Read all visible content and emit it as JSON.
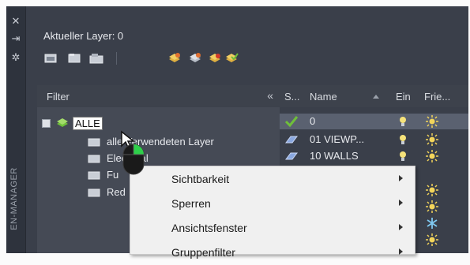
{
  "sidebar": {
    "close_icon": "close-icon",
    "pin_icon": "pin-icon",
    "settings_icon": "settings-icon",
    "title": "EN-MANAGER"
  },
  "header": {
    "current_layer": "Aktueller Layer: 0"
  },
  "toolbar": {
    "icons": [
      "new-property-filter-icon",
      "new-group-filter-icon",
      "layer-states-manager-icon",
      "new-layer-icon",
      "new-layer-vp-frozen-icon",
      "delete-layer-icon",
      "set-current-icon"
    ]
  },
  "filter_panel": {
    "label": "Filter",
    "collapse_glyph": "«",
    "tree": [
      {
        "label": "ALLE",
        "selected": true
      },
      {
        "label": "alle Verwendeten Layer"
      },
      {
        "label": "Electrical"
      },
      {
        "label": "Fu"
      },
      {
        "label": "Red"
      }
    ]
  },
  "grid": {
    "columns": [
      "S...",
      "Name",
      "Ein",
      "Frie..."
    ],
    "rows": [
      {
        "name": "0",
        "status": "current",
        "selected": true
      },
      {
        "name": "01 VIEWP...",
        "status": "layer"
      },
      {
        "name": "10 WALLS",
        "status": "layer"
      }
    ]
  },
  "context_menu": {
    "items": [
      {
        "label": "Sichtbarkeit",
        "submenu": true
      },
      {
        "label": "Sperren",
        "submenu": true
      },
      {
        "label": "Ansichtsfenster",
        "submenu": true
      },
      {
        "label": "Gruppenfilter",
        "submenu": true
      }
    ]
  },
  "colors": {
    "panel_bg": "#3a3f4a",
    "menu_bg": "#f0f0f0",
    "check_green": "#6fbf3a",
    "bulb_yellow": "#f5e27a",
    "sun_yellow": "#f2d45a",
    "freeze_blue": "#7fc8f0",
    "layer_blue": "#8aa8e0"
  }
}
